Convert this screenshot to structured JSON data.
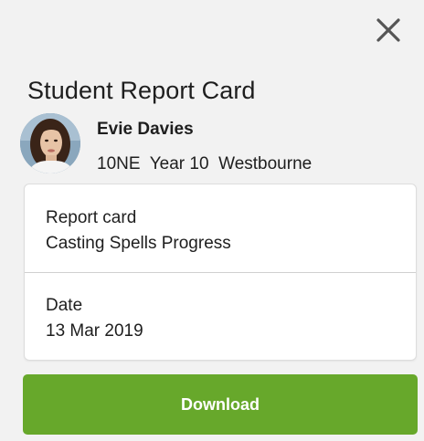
{
  "header": {
    "title": "Student Report Card",
    "close_icon": "close-icon"
  },
  "student": {
    "name": "Evie Davies",
    "form": "10NE",
    "year": "Year 10",
    "house": "Westbourne",
    "meta_line": "10NE  Year 10  Westbourne",
    "avatar_icon": "student-photo"
  },
  "report": {
    "report_card_label": "Report card",
    "report_card_value": "Casting Spells Progress",
    "date_label": "Date",
    "date_value": "13 Mar 2019"
  },
  "actions": {
    "download_label": "Download"
  },
  "colors": {
    "accent_green": "#67a82b",
    "background": "#f2f2f2",
    "card": "#ffffff",
    "text": "#1e1e1e"
  }
}
